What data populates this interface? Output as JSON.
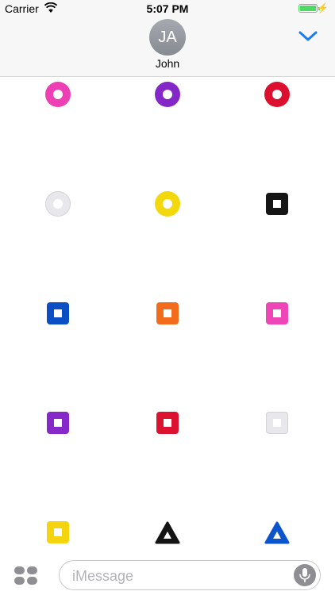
{
  "status_bar": {
    "carrier": "Carrier",
    "time": "5:07 PM",
    "battery_color": "#4cd964"
  },
  "header": {
    "avatar_initials": "JA",
    "contact_name": "John",
    "collapse_icon": "chevron-down-icon",
    "accent_color": "#1e7cf2"
  },
  "stickers": [
    {
      "row": 1,
      "items": [
        {
          "name": "pink-ring",
          "shape": "ring",
          "color": "#ee3fb4"
        },
        {
          "name": "purple-ring",
          "shape": "ring",
          "color": "#8427c9"
        },
        {
          "name": "red-ring",
          "shape": "ring",
          "color": "#dc102e"
        }
      ]
    },
    {
      "row": 2,
      "items": [
        {
          "name": "white-ring",
          "shape": "ring",
          "color": "#e8e8ec"
        },
        {
          "name": "yellow-ring",
          "shape": "ring",
          "color": "#f2d80c"
        },
        {
          "name": "black-square",
          "shape": "square",
          "color": "#151515"
        }
      ]
    },
    {
      "row": 3,
      "items": [
        {
          "name": "blue-square",
          "shape": "square",
          "color": "#0b4fc4"
        },
        {
          "name": "orange-square",
          "shape": "square",
          "color": "#f26c1c"
        },
        {
          "name": "pink-square",
          "shape": "square",
          "color": "#ee46b6"
        }
      ]
    },
    {
      "row": 4,
      "items": [
        {
          "name": "purple-square",
          "shape": "square",
          "color": "#8629c8"
        },
        {
          "name": "red-square",
          "shape": "square",
          "color": "#dc1230"
        },
        {
          "name": "white-square",
          "shape": "square",
          "color": "#e8e8ec"
        }
      ]
    },
    {
      "row": 5,
      "items": [
        {
          "name": "yellow-square",
          "shape": "square",
          "color": "#f4d40e"
        },
        {
          "name": "black-triangle",
          "shape": "triangle",
          "color": "#141414"
        },
        {
          "name": "blue-triangle",
          "shape": "triangle",
          "color": "#0b55cc"
        }
      ]
    }
  ],
  "input_bar": {
    "apps_icon": "app-drawer-icon",
    "placeholder": "iMessage",
    "mic_icon": "microphone-icon"
  }
}
